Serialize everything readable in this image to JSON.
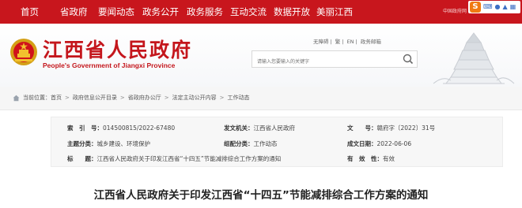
{
  "nav": {
    "items": [
      "首页",
      "省政府",
      "要闻动态",
      "政务公开",
      "政务服务",
      "互动交流",
      "数据开放",
      "美丽江西"
    ],
    "right_text": "中国政府网",
    "sogou_badge": "S"
  },
  "header": {
    "title": "江西省人民政府",
    "subtitle": "People's Government of Jiangxi Province",
    "util_links": [
      "无障碍",
      "繁",
      "EN",
      "政务邮箱"
    ],
    "search_placeholder": "请输入您要输入的关键字"
  },
  "breadcrumb": {
    "label": "当前位置：",
    "items": [
      "首页",
      "政府信息公开目录",
      "省政府办公厅",
      "法定主动公开内容",
      "工作动态"
    ]
  },
  "info": {
    "index_key": "索　引　号：",
    "index_val": "014500815/2022-67480",
    "topic_key": "主题分类：",
    "topic_val": "城乡建设、环境保护",
    "title_key": "标　　题：",
    "title_val": "江西省人民政府关于印发江西省“十四五”节能减排综合工作方案的通知",
    "issuer_key": "发文机关：",
    "issuer_val": "江西省人民政府",
    "category_key": "组配分类：",
    "category_val": "工作动态",
    "docno_key": "文　　号：",
    "docno_val": "赣府字〔2022〕31号",
    "date_key": "成文日期：",
    "date_val": "2022-06-06",
    "validity_key": "有　效　性：",
    "validity_val": "有效"
  },
  "doc_title": "江西省人民政府关于印发江西省“十四五”节能减排综合工作方案的通知"
}
